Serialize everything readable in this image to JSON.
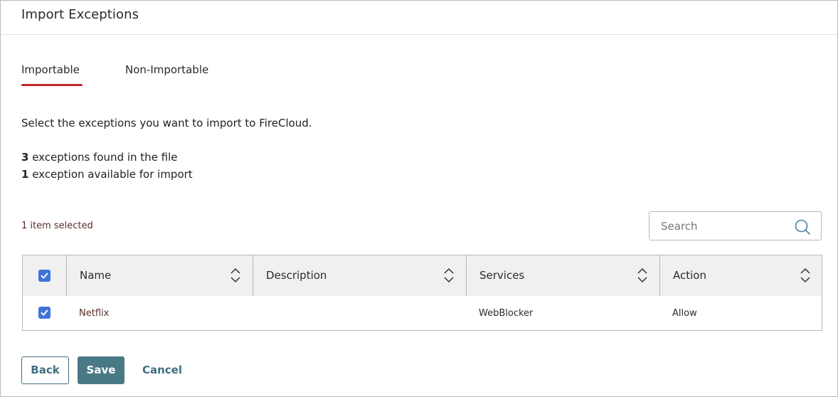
{
  "header": {
    "title": "Import Exceptions"
  },
  "tabs": [
    {
      "label": "Importable",
      "active": true
    },
    {
      "label": "Non-Importable",
      "active": false
    }
  ],
  "intro": "Select the exceptions you want to import to FireCloud.",
  "counts": {
    "found_number": "3",
    "found_text": " exceptions found in the file",
    "available_number": "1",
    "available_text": " exception available for import"
  },
  "selection": {
    "label": "1 item selected"
  },
  "search": {
    "placeholder": "Search",
    "value": "",
    "icon": "search-icon"
  },
  "table": {
    "header_checked": true,
    "columns": [
      "Name",
      "Description",
      "Services",
      "Action"
    ],
    "rows": [
      {
        "checked": true,
        "name": "Netflix",
        "description": "",
        "services": "WebBlocker",
        "action": "Allow"
      }
    ]
  },
  "buttons": {
    "back": "Back",
    "save": "Save",
    "cancel": "Cancel"
  },
  "colors": {
    "accent": "#c0272d",
    "checkbox": "#3f74d9",
    "primary_button": "#4a7986",
    "link": "#3f6f80"
  }
}
